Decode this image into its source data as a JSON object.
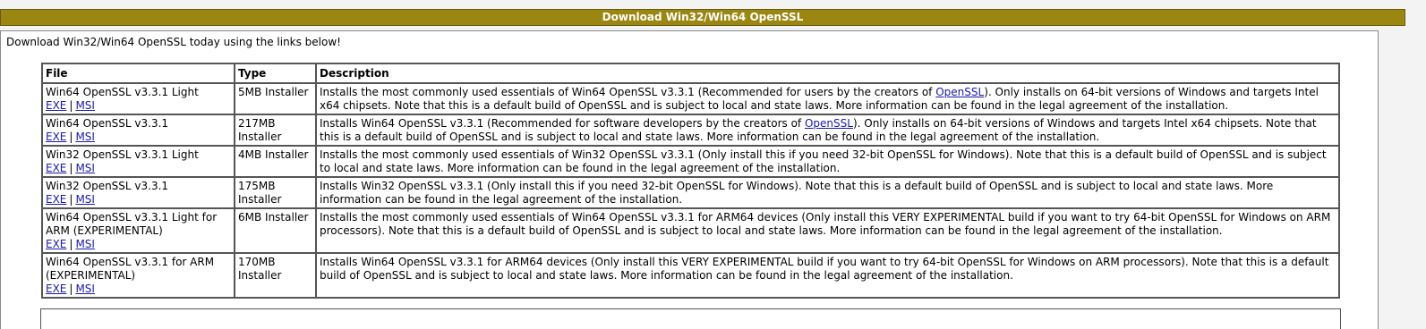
{
  "banner": {
    "title": "Download Win32/Win64 OpenSSL"
  },
  "intro": "Download Win32/Win64 OpenSSL today using the links below!",
  "table": {
    "headers": {
      "file": "File",
      "type": "Type",
      "description": "Description"
    },
    "rows": [
      {
        "file": "Win64 OpenSSL v3.3.1 Light",
        "exe": "EXE",
        "sep": "|",
        "msi": "MSI",
        "type": "5MB Installer",
        "desc_before": "Installs the most commonly used essentials of Win64 OpenSSL v3.3.1 (Recommended for users by the creators of ",
        "desc_link": "OpenSSL",
        "desc_after": "). Only installs on 64-bit versions of Windows and targets Intel x64 chipsets. Note that this is a default build of OpenSSL and is subject to local and state laws. More information can be found in the legal agreement of the installation."
      },
      {
        "file": "Win64 OpenSSL v3.3.1",
        "exe": "EXE",
        "sep": "|",
        "msi": "MSI",
        "type": "217MB Installer",
        "desc_before": "Installs Win64 OpenSSL v3.3.1 (Recommended for software developers by the creators of ",
        "desc_link": "OpenSSL",
        "desc_after": "). Only installs on 64-bit versions of Windows and targets Intel x64 chipsets. Note that this is a default build of OpenSSL and is subject to local and state laws. More information can be found in the legal agreement of the installation."
      },
      {
        "file": "Win32 OpenSSL v3.3.1 Light",
        "exe": "EXE",
        "sep": "|",
        "msi": "MSI",
        "type": "4MB Installer",
        "desc_before": "Installs the most commonly used essentials of Win32 OpenSSL v3.3.1 (Only install this if you need 32-bit OpenSSL for Windows). Note that this is a default build of OpenSSL and is subject to local and state laws. More information can be found in the legal agreement of the installation.",
        "desc_link": "",
        "desc_after": ""
      },
      {
        "file": "Win32 OpenSSL v3.3.1",
        "exe": "EXE",
        "sep": "|",
        "msi": "MSI",
        "type": "175MB Installer",
        "desc_before": "Installs Win32 OpenSSL v3.3.1 (Only install this if you need 32-bit OpenSSL for Windows). Note that this is a default build of OpenSSL and is subject to local and state laws. More information can be found in the legal agreement of the installation.",
        "desc_link": "",
        "desc_after": ""
      },
      {
        "file": "Win64 OpenSSL v3.3.1 Light for ARM (EXPERIMENTAL)",
        "exe": "EXE",
        "sep": "|",
        "msi": "MSI",
        "type": "6MB Installer",
        "desc_before": "Installs the most commonly used essentials of Win64 OpenSSL v3.3.1 for ARM64 devices (Only install this VERY EXPERIMENTAL build if you want to try 64-bit OpenSSL for Windows on ARM processors). Note that this is a default build of OpenSSL and is subject to local and state laws. More information can be found in the legal agreement of the installation.",
        "desc_link": "",
        "desc_after": ""
      },
      {
        "file": "Win64 OpenSSL v3.3.1 for ARM (EXPERIMENTAL)",
        "exe": "EXE",
        "sep": "|",
        "msi": "MSI",
        "type": "170MB Installer",
        "desc_before": "Installs Win64 OpenSSL v3.3.1 for ARM64 devices (Only install this VERY EXPERIMENTAL build if you want to try 64-bit OpenSSL for Windows on ARM processors). Note that this is a default build of OpenSSL and is subject to local and state laws. More information can be found in the legal agreement of the installation.",
        "desc_link": "",
        "desc_after": ""
      }
    ]
  }
}
